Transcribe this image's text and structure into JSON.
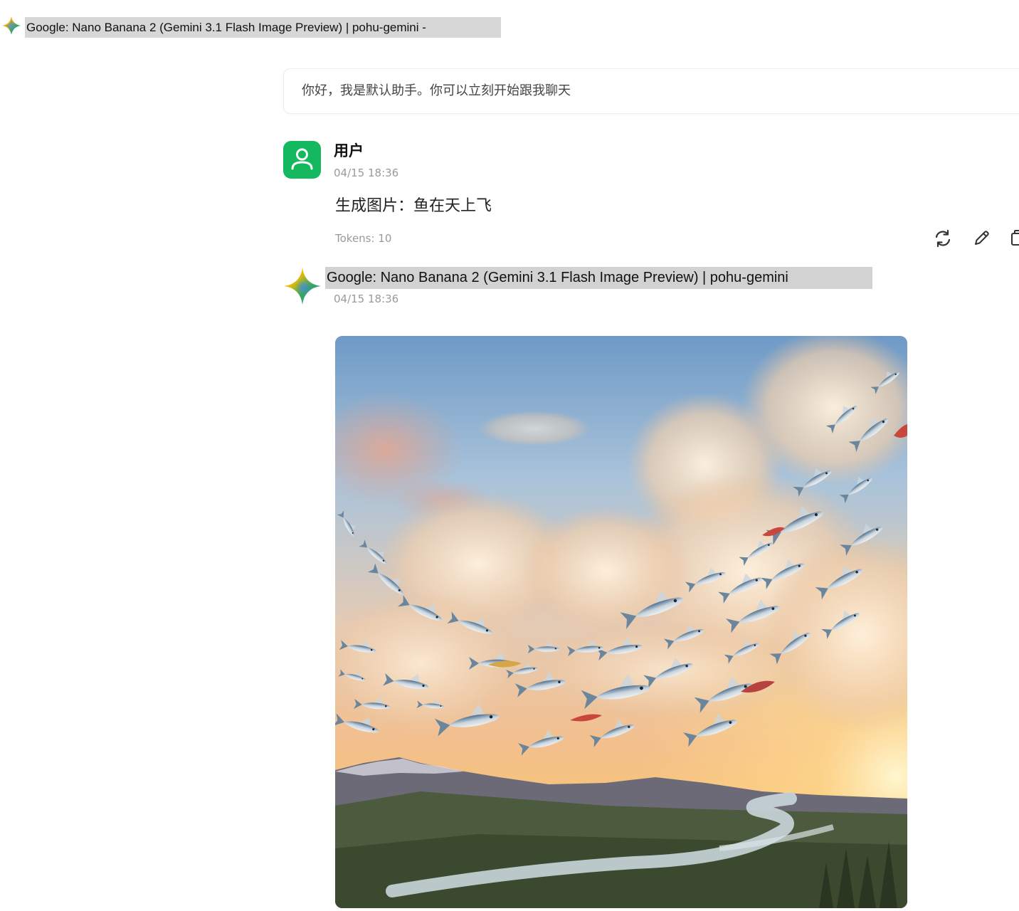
{
  "header": {
    "title": "Google: Nano Banana 2 (Gemini 3.1 Flash Image Preview) | pohu-gemini -",
    "icon": "gemini-star-icon"
  },
  "greeting": {
    "text": "你好，我是默认助手。你可以立刻开始跟我聊天"
  },
  "user_message": {
    "author": "用户",
    "time": "04/15 18:36",
    "text": "生成图片：鱼在天上飞",
    "tokens": "Tokens: 10",
    "avatar_icon": "user-icon",
    "avatar_color": "#14b95f",
    "actions": [
      "refresh-icon",
      "pencil-icon",
      "copy-icon"
    ]
  },
  "assistant_message": {
    "author": "Google: Nano Banana 2 (Gemini 3.1 Flash Image Preview) | pohu-gemini",
    "time": "04/15 18:36",
    "icon": "gemini-star-icon",
    "image": "generated-image"
  }
}
